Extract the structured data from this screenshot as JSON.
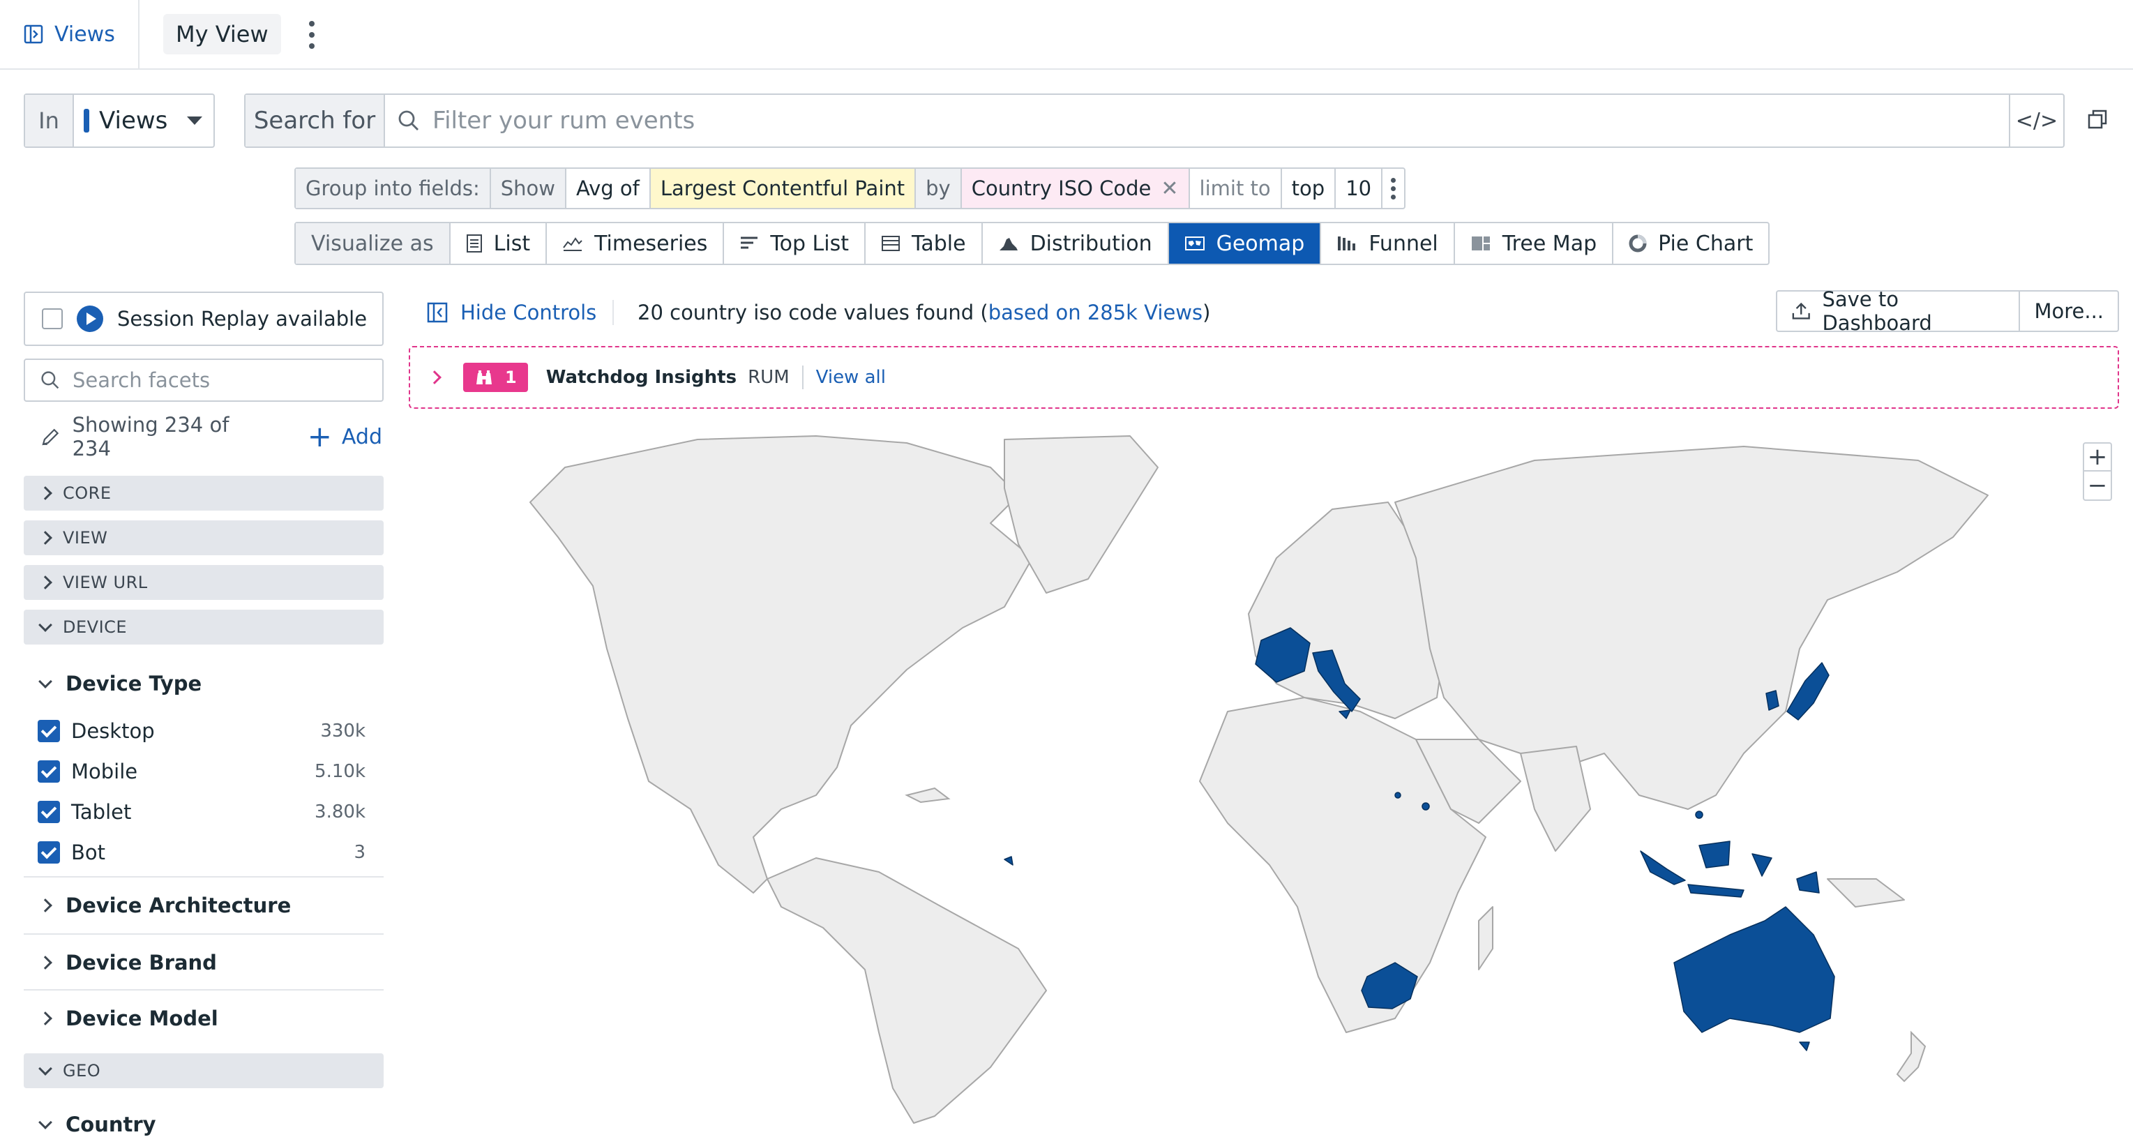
{
  "topbar": {
    "views_label": "Views",
    "view_name": "My View"
  },
  "query": {
    "in_label": "In",
    "in_value": "Views",
    "search_for_label": "Search for",
    "search_placeholder": "Filter your rum events",
    "code_label": "</>"
  },
  "group": {
    "label": "Group into fields:",
    "show": "Show",
    "agg": "Avg of",
    "measure": "Largest Contentful Paint",
    "by": "by",
    "field": "Country ISO Code",
    "limit_to": "limit to",
    "top": "top",
    "limit": "10"
  },
  "visualize": {
    "label": "Visualize as",
    "options": [
      {
        "label": "List",
        "icon": "list-icon",
        "active": false
      },
      {
        "label": "Timeseries",
        "icon": "timeseries-icon",
        "active": false
      },
      {
        "label": "Top List",
        "icon": "toplist-icon",
        "active": false
      },
      {
        "label": "Table",
        "icon": "table-icon",
        "active": false
      },
      {
        "label": "Distribution",
        "icon": "distribution-icon",
        "active": false
      },
      {
        "label": "Geomap",
        "icon": "geomap-icon",
        "active": true
      },
      {
        "label": "Funnel",
        "icon": "funnel-icon",
        "active": false
      },
      {
        "label": "Tree Map",
        "icon": "treemap-icon",
        "active": false
      },
      {
        "label": "Pie Chart",
        "icon": "piechart-icon",
        "active": false
      }
    ]
  },
  "sidebar": {
    "session_replay": "Session Replay available",
    "facet_search_placeholder": "Search facets",
    "showing": "Showing 234 of 234",
    "add": "Add",
    "sections": {
      "core": "CORE",
      "view": "VIEW",
      "view_url": "VIEW URL",
      "device": "DEVICE",
      "geo": "GEO"
    },
    "device_type": {
      "title": "Device Type",
      "items": [
        {
          "label": "Desktop",
          "count": "330k"
        },
        {
          "label": "Mobile",
          "count": "5.10k"
        },
        {
          "label": "Tablet",
          "count": "3.80k"
        },
        {
          "label": "Bot",
          "count": "3"
        }
      ]
    },
    "facets": {
      "arch": "Device Architecture",
      "brand": "Device Brand",
      "model": "Device Model",
      "country": "Country"
    }
  },
  "main": {
    "hide_controls": "Hide Controls",
    "found_prefix": "20 country iso code values found (",
    "found_link": "based on 285k Views",
    "found_suffix": ")",
    "save_dashboard": "Save to Dashboard",
    "more": "More...",
    "watchdog": {
      "count": "1",
      "title": "Watchdog Insights",
      "source": "RUM",
      "view_all": "View all"
    },
    "zoom_in": "+",
    "zoom_out": "−"
  },
  "colors": {
    "accent": "#1a5fb4",
    "highlight_country": "#0b4f97",
    "land": "#ededed",
    "watchdog": "#e0358b"
  }
}
